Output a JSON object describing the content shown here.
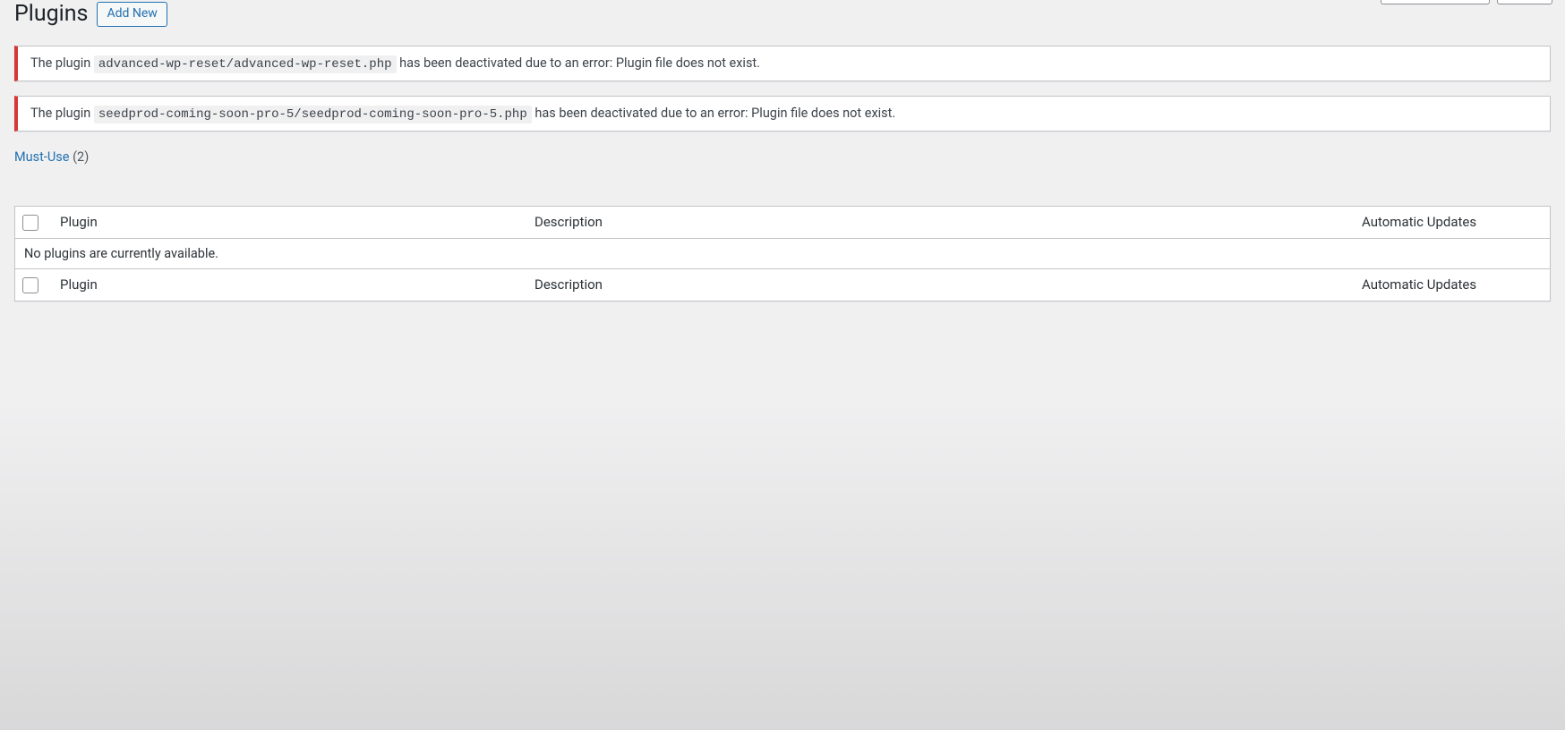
{
  "header": {
    "title": "Plugins",
    "add_new_label": "Add New"
  },
  "notices": [
    {
      "before": "The plugin ",
      "code": "advanced-wp-reset/advanced-wp-reset.php",
      "after": " has been deactivated due to an error: Plugin file does not exist."
    },
    {
      "before": "The plugin ",
      "code": "seedprod-coming-soon-pro-5/seedprod-coming-soon-pro-5.php",
      "after": " has been deactivated due to an error: Plugin file does not exist."
    }
  ],
  "filters": {
    "must_use_label": "Must-Use",
    "must_use_count": "(2)"
  },
  "table": {
    "col_plugin": "Plugin",
    "col_description": "Description",
    "col_auto_updates": "Automatic Updates",
    "no_items": "No plugins are currently available."
  }
}
